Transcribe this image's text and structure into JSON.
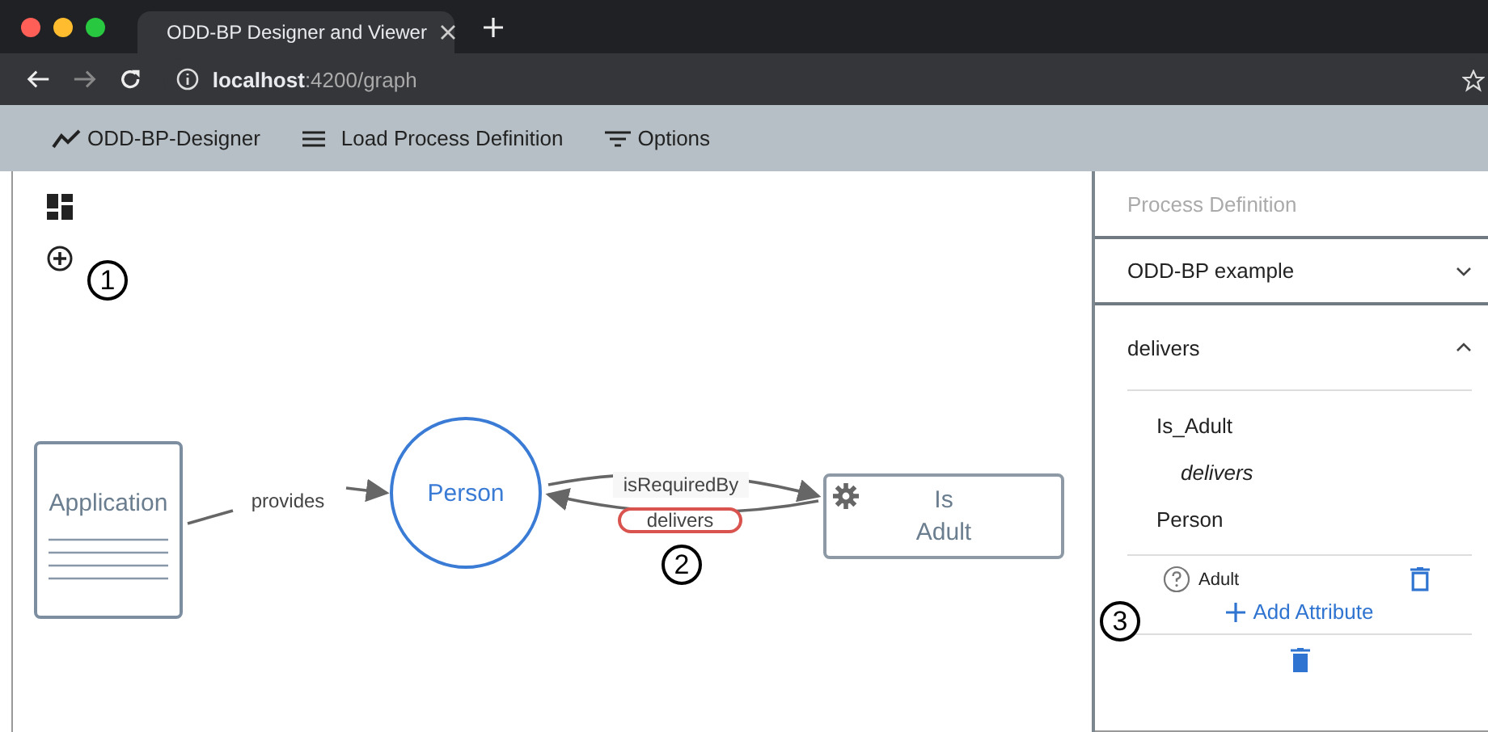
{
  "browser": {
    "tab_title": "ODD-BP Designer and Viewer",
    "url_host": "localhost",
    "url_path": ":4200/graph"
  },
  "toolbar": [
    {
      "kind": "logo",
      "label": "ODD-BP-Designer"
    },
    {
      "kind": "menu",
      "label": "Load Process Definition"
    },
    {
      "kind": "filter",
      "label": "Options"
    }
  ],
  "graph": {
    "nodes": [
      {
        "kind": "document",
        "label": "Application"
      },
      {
        "kind": "circle",
        "label": "Person"
      },
      {
        "kind": "task",
        "label": "Is Adult"
      }
    ],
    "edges": [
      {
        "label": "provides",
        "selected": false
      },
      {
        "label": "isRequiredBy",
        "selected": false
      },
      {
        "label": "delivers",
        "selected": true
      }
    ]
  },
  "annotations": [
    "1",
    "2",
    "3"
  ],
  "panel": {
    "header": "Process Definition",
    "sections": [
      {
        "title": "ODD-BP example",
        "expanded": false
      },
      {
        "title": "delivers",
        "expanded": true,
        "source": "Is_Adult",
        "relation": "delivers",
        "target": "Person",
        "attributes": [
          {
            "name": "Adult"
          }
        ],
        "add_label": "Add Attribute"
      }
    ]
  }
}
